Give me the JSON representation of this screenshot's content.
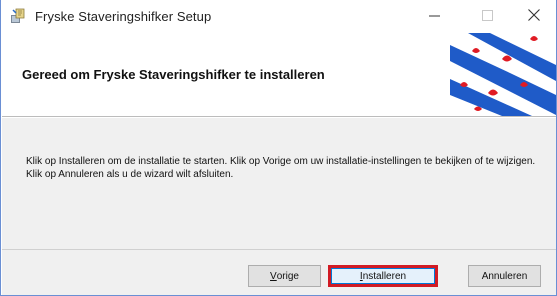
{
  "window": {
    "title": "Fryske Staveringshifker Setup"
  },
  "header": {
    "title": "Gereed om Fryske Staveringshifker te installeren"
  },
  "content": {
    "body": "Klik op Installeren om de installatie te starten. Klik op Vorige om uw installatie-instellingen te bekijken of te wijzigen. Klik op Annuleren als u de wizard wilt afsluiten."
  },
  "buttons": {
    "back_first": "V",
    "back_rest": "orige",
    "install_first": "I",
    "install_rest": "nstalleren",
    "cancel": "Annuleren"
  },
  "icons": {
    "app": "installer-icon",
    "minimize": "minimize-icon",
    "maximize": "maximize-icon",
    "close": "close-icon",
    "flag": "frisian-flag"
  },
  "colors": {
    "highlight": "#d11b24",
    "flag_blue": "#1f5bc8",
    "flag_red": "#e01b24"
  }
}
